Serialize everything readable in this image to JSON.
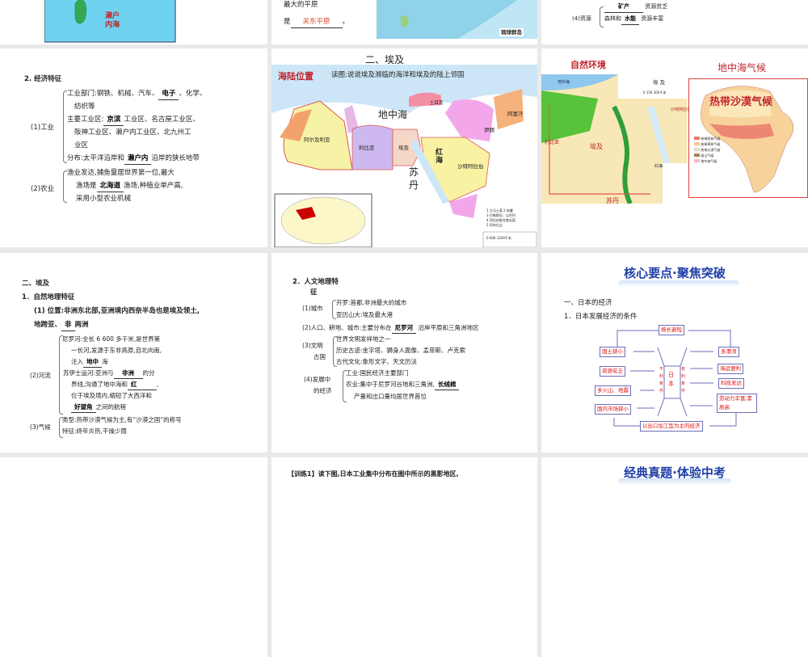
{
  "slides": {
    "s1": {
      "map_label": "濑户内海"
    },
    "s2": {
      "q1": "最大的平原",
      "q2_prefix": "是",
      "answer": "关东平原",
      "q2_suffix": "。",
      "map_label": "琉球群岛"
    },
    "s3": {
      "label": "(4)资源",
      "l1_blank": "矿产",
      "l1_suffix": "资源贫乏",
      "l2_prefix": "森林和",
      "l2_blank": "水能",
      "l2_suffix": "资源丰富"
    },
    "s4": {
      "title": "2. 经济特征",
      "ind_label": "(1)工业",
      "i1a": "工业部门:钢铁、机械、汽车、",
      "i1b": "电子",
      "i1c": "、化学、",
      "i1d": "纺织等",
      "i2a": "主要工业区:",
      "i2b": "京滨",
      "i2c": "工业区、名古屋工业区、",
      "i2d": "阪神工业区、濑户内工业区、北九州工",
      "i2e": "业区",
      "i3a": "分布:太平洋沿岸和",
      "i3b": "濑户内",
      "i3c": "沿岸的狭长地带",
      "agr_label": "(2)农业",
      "a1": "渔业发达,捕鱼量居世界第一位,最大",
      "a2a": "渔场是",
      "a2b": "北海道",
      "a2c": "渔场,种植业单产高,",
      "a3": "采用小型农业机械"
    },
    "s5": {
      "heading": "二、埃及",
      "subtitle": "读图:说说埃及濒临的海洋和埃及的陆上邻国",
      "tag": "海陆位置",
      "labels": [
        "地中海",
        "红海",
        "苏丹",
        "阿尔及利亚",
        "利比亚",
        "埃及",
        "沙特阿拉伯",
        "伊朗",
        "阿富汗",
        "土耳其"
      ],
      "legend": [
        "1 大马士革  2 安曼",
        "3 巴勒斯坦、以色列",
        "4 阿拉伯联合酋长国",
        "5 阿布扎比"
      ],
      "scale": "0  600  1200千米"
    },
    "s6": {
      "tag1": "自然环境",
      "tag2": "地中海气候",
      "tag3": "热带沙漠气候",
      "map_title": "埃  及",
      "labels": [
        "地中海",
        "利比亚",
        "埃及",
        "苏丹",
        "红海",
        "沙特阿拉伯"
      ],
      "scale": "0  150  300千米",
      "legend": [
        "热带雨林气候",
        "热带草原气候",
        "热带沙漠气候",
        "高山气候",
        "地中海气候"
      ],
      "legend_colors": [
        "#e8736b",
        "#f7c98f",
        "#fbe7b9",
        "#a5845b",
        "#f4b6bf"
      ]
    },
    "s7": {
      "h1": "二、埃及",
      "h2": "1．自然地理特征",
      "p1": "(1) 位置:非洲东北部,亚洲境内西奈半岛也是埃及领土,",
      "p2a": "地跨亚、",
      "p2b": "非",
      "p2c": "两洲",
      "river_label": "(2)河流",
      "r1": "尼罗河:全长 6 600 多千米,是世界第",
      "r2": "一长河,发源于东非高原,自北向南,",
      "r3a": "注入",
      "r3b": "地中",
      "r3c": "海",
      "r4a": "苏伊士运河:亚洲与",
      "r4b": "非洲",
      "r4c": "的分",
      "r5a": "界线,沟通了地中海和",
      "r5b": "红",
      "r5c": ",",
      "r6": "位于埃及境内,缩短了大西洋和",
      "r7a": "好望角",
      "r7b": "之间的航程",
      "clim_label": "(3)气候",
      "c1": "类型:热带沙漠气候为主,有“沙漠之国”的称号",
      "c2": "特征:终年炎热,干燥少雨"
    },
    "s8": {
      "h1": "2．人文地理特",
      "h1b": "征",
      "city_label": "(1)城市",
      "c1": "开罗:首都,非洲最大的城市",
      "c2": "亚历山大:埃及最大港",
      "p2a": "(2)人口、耕地、城市:主要分布在",
      "p2b": "尼罗河",
      "p2c": "沿岸平原和三角洲地区",
      "civ_label1": "(3)文明",
      "civ_label2": "古国",
      "v1": "世界文明发祥地之一",
      "v2": "历史古迹:金字塔、狮身人面像、孟菲斯、卢克索",
      "v3": "古代文化:象形文字、天文历法",
      "eco_label1": "(4)发展中",
      "eco_label2": "的经济",
      "e1": "工业:国民经济主要部门",
      "e2a": "农业:集中于尼罗河谷地和三角洲,",
      "e2b": "长绒棉",
      "e3": "产量和出口量均居世界首位"
    },
    "s9": {
      "header": "核心要点·聚焦突破",
      "h1": "一、日本的经济",
      "h2": "1．日本发展经济的条件",
      "top": "扬长避短",
      "left": [
        "国土狭小",
        "资源贫乏",
        "多火山、地震",
        "国内市场狭小"
      ],
      "right": [
        "多港湾",
        "海运便利",
        "科技发达",
        "劳动力丰富,素质高"
      ],
      "center": "日本",
      "bad": "不利条件",
      "good": "有利条件",
      "bottom": "以出口加工型为主的经济"
    },
    "s10": {
      "text": "【训练1】读下图,日本工业集中分布在图中所示的黑影地区,"
    },
    "s11": {
      "header": "经典真题·体验中考"
    }
  }
}
